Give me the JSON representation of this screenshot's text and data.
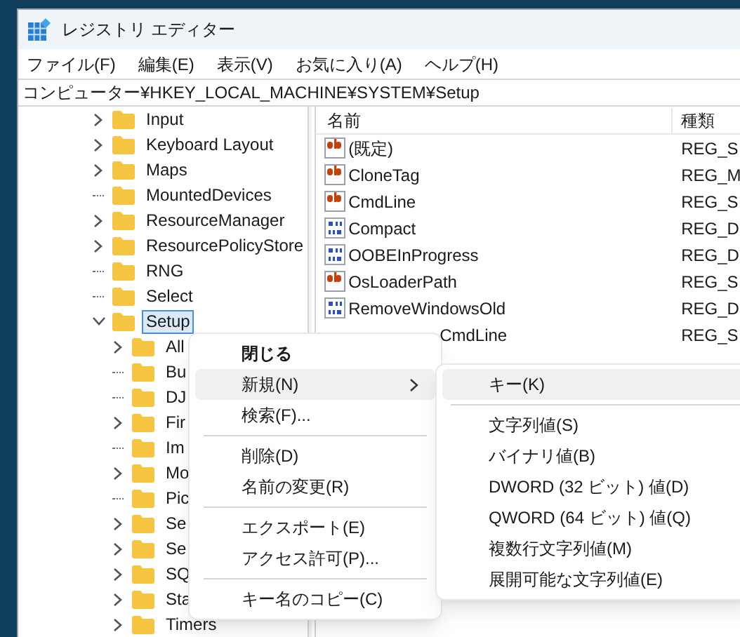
{
  "window": {
    "title": "レジストリ エディター"
  },
  "menu_bar": [
    "ファイル(F)",
    "編集(E)",
    "表示(V)",
    "お気に入り(A)",
    "ヘルプ(H)"
  ],
  "address": "コンピューター¥HKEY_LOCAL_MACHINE¥SYSTEM¥Setup",
  "tree": [
    {
      "label": "Input",
      "expandable": true,
      "expanded": false,
      "selected": false
    },
    {
      "label": "Keyboard Layout",
      "expandable": true,
      "expanded": false,
      "selected": false
    },
    {
      "label": "Maps",
      "expandable": true,
      "expanded": false,
      "selected": false
    },
    {
      "label": "MountedDevices",
      "expandable": false,
      "selected": false
    },
    {
      "label": "ResourceManager",
      "expandable": true,
      "expanded": false,
      "selected": false
    },
    {
      "label": "ResourcePolicyStore",
      "expandable": true,
      "expanded": false,
      "selected": false
    },
    {
      "label": "RNG",
      "expandable": false,
      "selected": false
    },
    {
      "label": "Select",
      "expandable": false,
      "selected": false
    },
    {
      "label": "Setup",
      "expandable": true,
      "expanded": true,
      "selected": true,
      "children": [
        {
          "label": "All",
          "expandable": true,
          "expanded": false,
          "selected": false
        },
        {
          "label": "Bu",
          "expandable": false,
          "selected": false
        },
        {
          "label": "DJ",
          "expandable": false,
          "selected": false
        },
        {
          "label": "Fir",
          "expandable": true,
          "expanded": false,
          "selected": false
        },
        {
          "label": "Im",
          "expandable": false,
          "selected": false
        },
        {
          "label": "Mo",
          "expandable": true,
          "expanded": false,
          "selected": false
        },
        {
          "label": "Pic",
          "expandable": false,
          "selected": false
        },
        {
          "label": "Se",
          "expandable": true,
          "expanded": false,
          "selected": false
        },
        {
          "label": "Se",
          "expandable": true,
          "expanded": false,
          "selected": false
        },
        {
          "label": "SQ",
          "expandable": true,
          "expanded": false,
          "selected": false
        },
        {
          "label": "Sta",
          "expandable": true,
          "expanded": false,
          "selected": false
        },
        {
          "label": "Timers",
          "expandable": true,
          "expanded": false,
          "selected": false
        }
      ]
    }
  ],
  "table": {
    "columns": [
      "名前",
      "種類"
    ],
    "rows": [
      {
        "kind": "string",
        "name": "(既定)",
        "type": "REG_S"
      },
      {
        "kind": "string",
        "name": "CloneTag",
        "type": "REG_M"
      },
      {
        "kind": "string",
        "name": "CmdLine",
        "type": "REG_S"
      },
      {
        "kind": "binary",
        "name": "Compact",
        "type": "REG_D"
      },
      {
        "kind": "binary",
        "name": "OOBEInProgress",
        "type": "REG_D"
      },
      {
        "kind": "string",
        "name": "OsLoaderPath",
        "type": "REG_S"
      },
      {
        "kind": "binary",
        "name": "RemoveWindowsOld",
        "type": "REG_D"
      },
      {
        "kind": "covered",
        "name": "CmdLine",
        "type": "REG_S"
      }
    ]
  },
  "context_menu": [
    {
      "kind": "item",
      "label": "閉じる",
      "selected": false,
      "bold": true
    },
    {
      "kind": "submenu",
      "label": "新規(N)",
      "selected": true,
      "bold": false
    },
    {
      "kind": "item",
      "label": "検索(F)...",
      "selected": false,
      "bold": false
    },
    {
      "kind": "separator"
    },
    {
      "kind": "item",
      "label": "削除(D)",
      "selected": false,
      "bold": false
    },
    {
      "kind": "item",
      "label": "名前の変更(R)",
      "selected": false,
      "bold": false
    },
    {
      "kind": "separator"
    },
    {
      "kind": "item",
      "label": "エクスポート(E)",
      "selected": false,
      "bold": false
    },
    {
      "kind": "item",
      "label": "アクセス許可(P)...",
      "selected": false,
      "bold": false
    },
    {
      "kind": "separator"
    },
    {
      "kind": "item",
      "label": "キー名のコピー(C)",
      "selected": false,
      "bold": false
    }
  ],
  "submenu": [
    {
      "kind": "item",
      "label": "キー(K)",
      "selected": true
    },
    {
      "kind": "separator"
    },
    {
      "kind": "item",
      "label": "文字列値(S)",
      "selected": false
    },
    {
      "kind": "item",
      "label": "バイナリ値(B)",
      "selected": false
    },
    {
      "kind": "item",
      "label": "DWORD (32 ビット) 値(D)",
      "selected": false
    },
    {
      "kind": "item",
      "label": "QWORD (64 ビット) 値(Q)",
      "selected": false
    },
    {
      "kind": "item",
      "label": "複数行文字列値(M)",
      "selected": false
    },
    {
      "kind": "item",
      "label": "展開可能な文字列値(E)",
      "selected": false
    }
  ]
}
